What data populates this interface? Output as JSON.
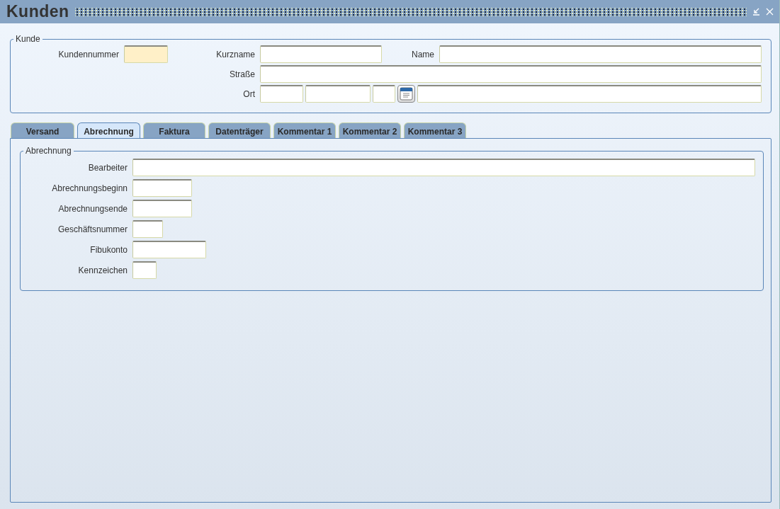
{
  "window": {
    "title": "Kunden"
  },
  "kunde": {
    "title": "Kunde",
    "fields": [
      {
        "label": "Kundennummer",
        "required": true
      },
      {
        "label": "Kurzname",
        "required": false
      },
      {
        "label": "Name",
        "required": false
      },
      {
        "label": "Straße",
        "required": false
      },
      {
        "label": "Ort",
        "required": false
      }
    ]
  },
  "tabs": [
    {
      "label": "Versand",
      "selected": false
    },
    {
      "label": "Abrechnung",
      "selected": true
    },
    {
      "label": "Faktura",
      "selected": false
    },
    {
      "label": "Datenträger",
      "selected": false
    },
    {
      "label": "Kommentar 1",
      "selected": false
    },
    {
      "label": "Kommentar 2",
      "selected": false
    },
    {
      "label": "Kommentar 3",
      "selected": false
    }
  ],
  "abrechnung": {
    "title": "Abrechnung",
    "fields": [
      {
        "label": "Bearbeiter"
      },
      {
        "label": "Abrechnungsbeginn"
      },
      {
        "label": "Abrechnungsende"
      },
      {
        "label": "Geschäftsnummer"
      },
      {
        "label": "Fibukonto"
      },
      {
        "label": "Kennzeichen"
      }
    ]
  }
}
